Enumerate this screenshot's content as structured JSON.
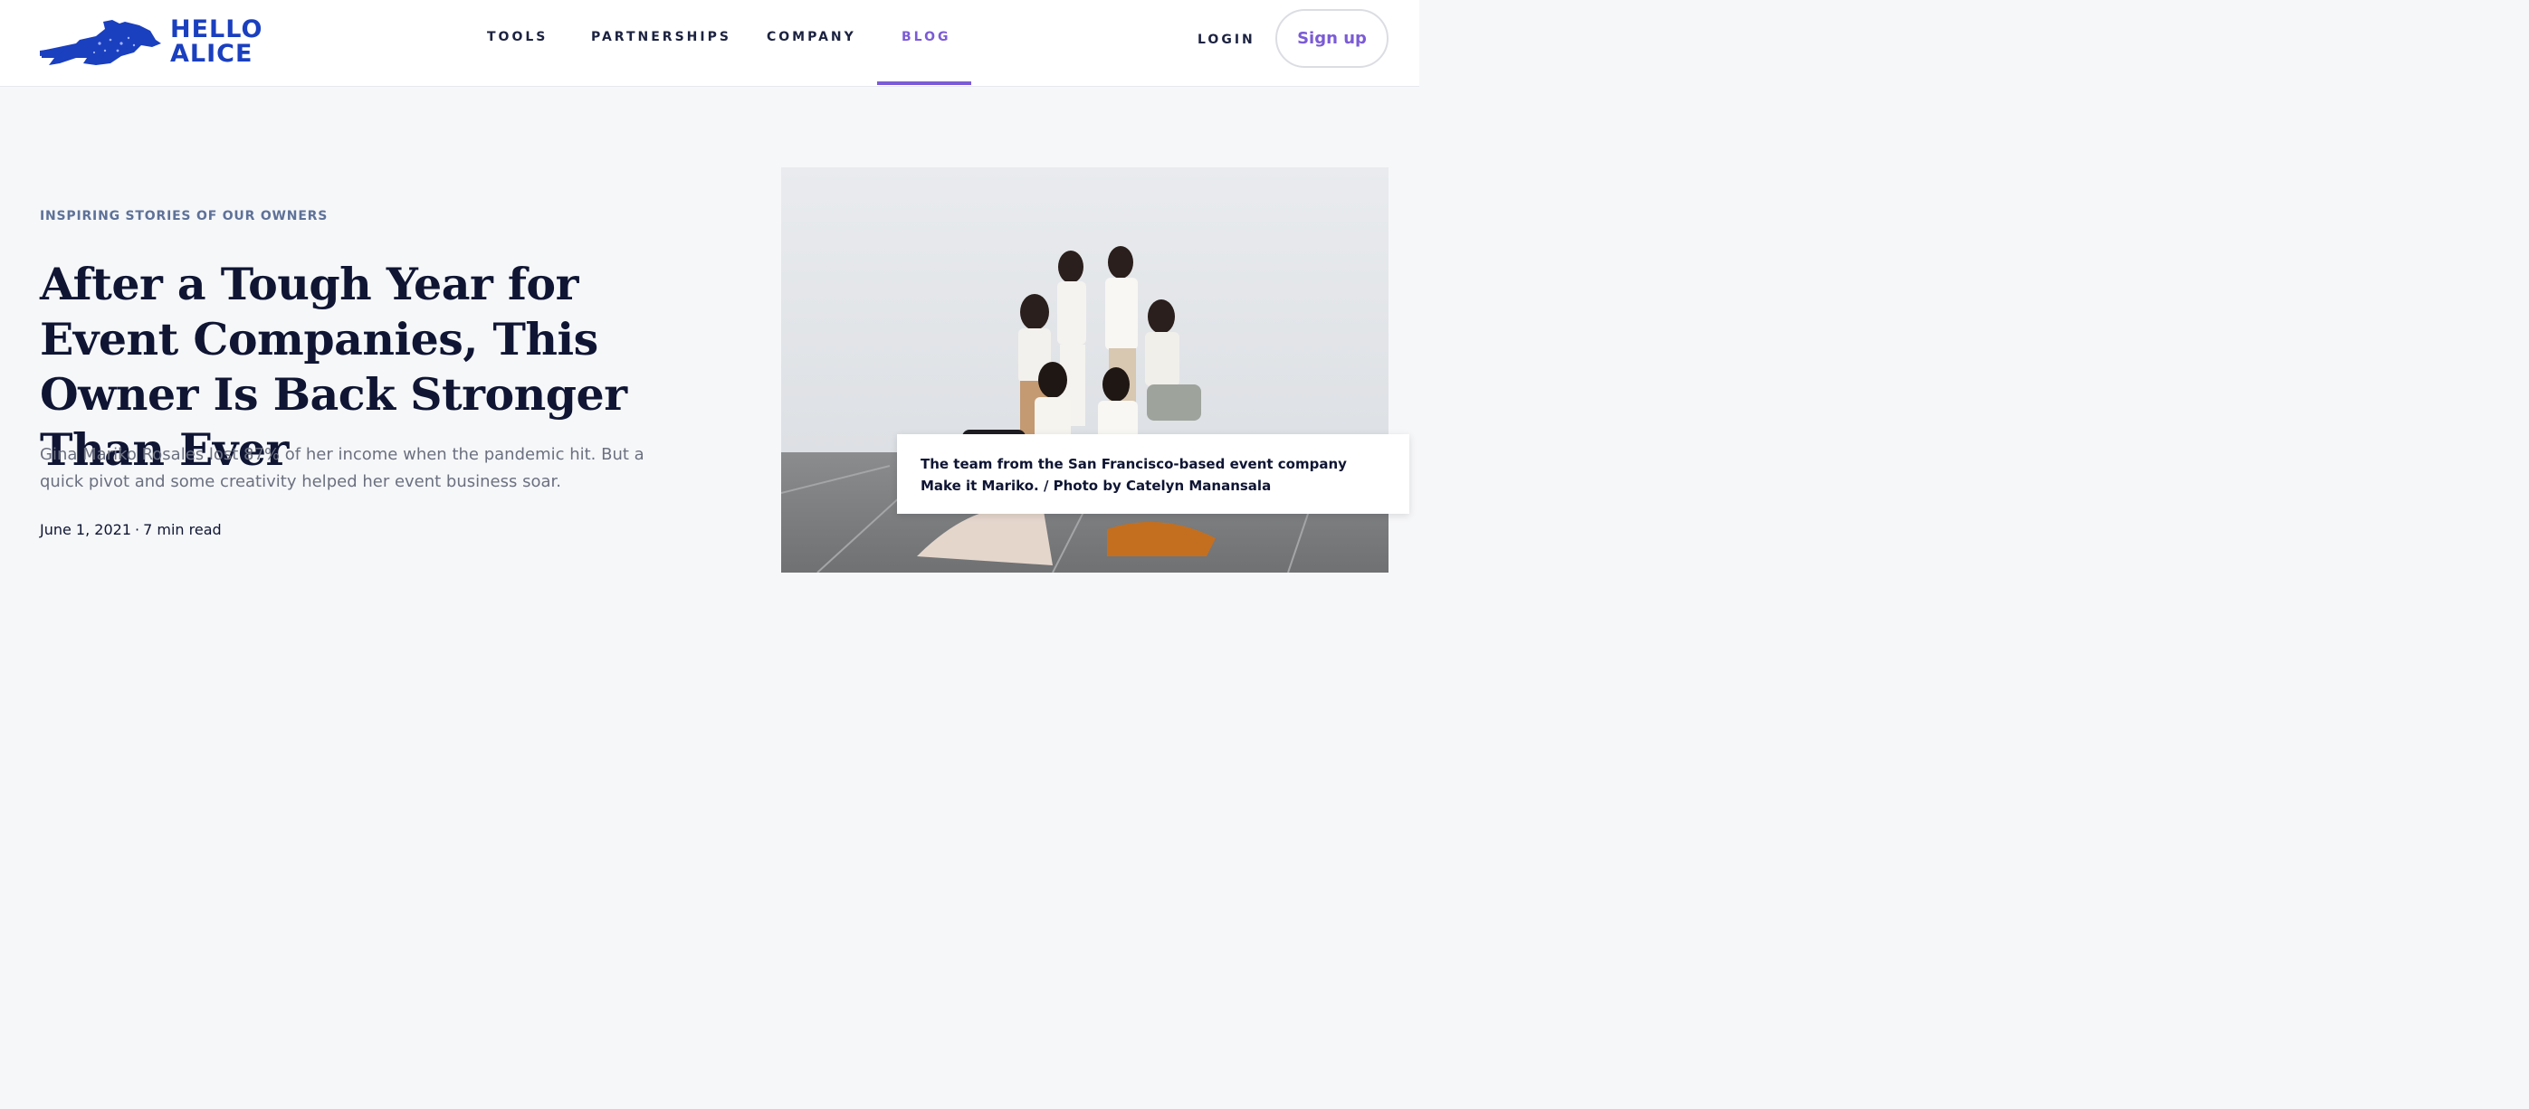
{
  "header": {
    "logo_lines": [
      "HELLO",
      "ALICE"
    ],
    "nav": [
      {
        "label": "TOOLS"
      },
      {
        "label": "PARTNERSHIPS"
      },
      {
        "label": "COMPANY"
      },
      {
        "label": "BLOG",
        "active": true
      }
    ],
    "login_label": "LOGIN",
    "signup_label": "Sign up"
  },
  "article": {
    "category": "INSPIRING STORIES OF OUR OWNERS",
    "title": "After a Tough Year for Event Companies, This Owner Is Back Stronger Than Ever",
    "summary": "Gina Mariko Rosales lost 87% of her income when the pandemic hit. But a quick pivot and some creativity helped her event business soar.",
    "date": "June 1, 2021",
    "separator": "·",
    "read_time": "7 min read",
    "image_caption": "The team from the San Francisco-based event company Make it Mariko. / Photo by Catelyn Manansala"
  },
  "colors": {
    "brand_blue": "#1a3fbf",
    "accent_purple": "#7b5bd6",
    "heading": "#0f1533",
    "category": "#5e7198",
    "background": "#f6f7f9"
  },
  "icons": {
    "logo": "rabbit-logo-icon"
  }
}
